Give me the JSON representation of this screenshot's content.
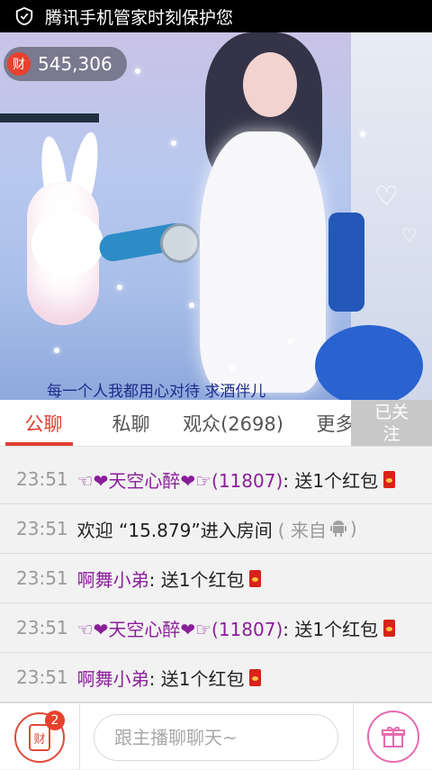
{
  "status_bar": {
    "text": "腾讯手机管家时刻保护您"
  },
  "video": {
    "wealth_icon": "财",
    "wealth_count": "545,306",
    "caption": "每一个人我都用心对待   求酒伴儿"
  },
  "tabs": [
    {
      "label": "公聊",
      "active": true
    },
    {
      "label": "私聊",
      "active": false
    },
    {
      "label": "观众(2698)",
      "active": false
    },
    {
      "label": "更多",
      "active": false
    }
  ],
  "follow_button": {
    "label_line1": "已关",
    "label_line2": "注"
  },
  "chat": [
    {
      "time": "23:51",
      "name": "☜❤天空心醉❤☞(11807)",
      "text": ": 送1个红包",
      "redbag": true
    },
    {
      "time": "23:51",
      "prefix": "欢迎 “15.879”进入房间",
      "suffix_open": "( 来自",
      "suffix_close": ")",
      "android": true
    },
    {
      "time": "23:51",
      "name": "啊舞小弟",
      "text": ": 送1个红包",
      "redbag": true
    },
    {
      "time": "23:51",
      "name": "☜❤天空心醉❤☞(11807)",
      "text": ": 送1个红包",
      "redbag": true
    },
    {
      "time": "23:51",
      "name": "啊舞小弟",
      "text": ": 送1个红包",
      "redbag": true
    }
  ],
  "bottom": {
    "bag_label": "财",
    "bag_badge": "2",
    "input_placeholder": "跟主播聊聊天~"
  },
  "colors": {
    "accent": "#e0402f",
    "name": "#8a1e9a",
    "gift": "#e56ab0"
  }
}
